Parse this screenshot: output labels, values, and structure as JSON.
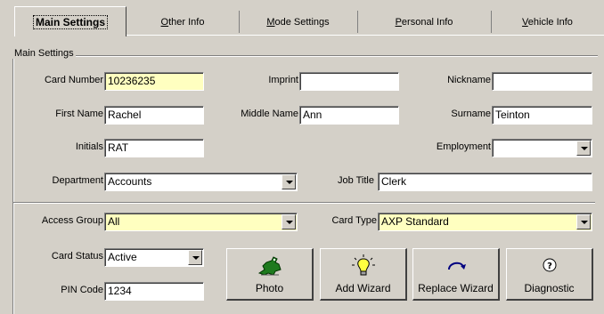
{
  "tabs": [
    {
      "label": "Main Settings",
      "active": true
    },
    {
      "label": "Other Info",
      "underline": "O"
    },
    {
      "label": "Mode Settings",
      "underline": "M"
    },
    {
      "label": "Personal Info",
      "underline": "P"
    },
    {
      "label": "Vehicle Info",
      "underline": "V"
    }
  ],
  "group_title": "Main Settings",
  "fields": {
    "card_number": {
      "label": "Card Number",
      "value": "10236235"
    },
    "imprint": {
      "label": "Imprint",
      "value": ""
    },
    "nickname": {
      "label": "Nickname",
      "value": ""
    },
    "first_name": {
      "label": "First Name",
      "value": "Rachel"
    },
    "middle_name": {
      "label": "Middle Name",
      "value": "Ann"
    },
    "surname": {
      "label": "Surname",
      "value": "Teinton"
    },
    "initials": {
      "label": "Initials",
      "value": "RAT"
    },
    "employment": {
      "label": "Employment",
      "value": ""
    },
    "department": {
      "label": "Department",
      "value": "Accounts"
    },
    "job_title": {
      "label": "Job Title",
      "value": "Clerk"
    },
    "access_group": {
      "label": "Access Group",
      "value": "All"
    },
    "card_type": {
      "label": "Card Type",
      "value": "AXP Standard"
    },
    "card_status": {
      "label": "Card Status",
      "value": "Active"
    },
    "pin_code": {
      "label": "PIN Code",
      "value": "1234"
    }
  },
  "buttons": {
    "photo": "Photo",
    "add_wizard": "Add Wizard",
    "replace_wizard": "Replace Wizard",
    "diagnostic": "Diagnostic"
  },
  "icons": {
    "photo": "alligator-icon",
    "add_wizard": "lightbulb-icon",
    "replace_wizard": "curved-arrow-icon",
    "diagnostic": "question-icon"
  },
  "colors": {
    "window_bg": "#d4d0c8",
    "required_field_bg": "#ffffc0"
  }
}
